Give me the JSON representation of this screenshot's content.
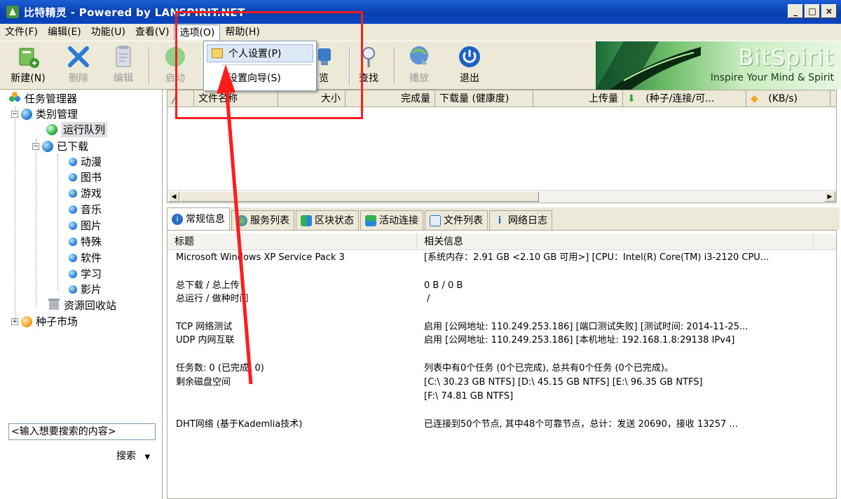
{
  "window": {
    "title": "比特精灵 - Powered by LANSPIRIT.NET",
    "buttons": [
      "_",
      "□",
      "×"
    ]
  },
  "menubar": {
    "items": [
      "文件(F)",
      "编辑(E)",
      "功能(U)",
      "查看(V)",
      "选项(O)",
      "帮助(H)"
    ]
  },
  "toolbar": {
    "buttons": [
      {
        "label": "新建(N)",
        "icon": "new-task-icon"
      },
      {
        "label": "删除",
        "icon": "delete-icon",
        "disabled": true
      },
      {
        "label": "编辑",
        "icon": "edit-icon",
        "disabled": true
      },
      {
        "label": "启动",
        "icon": "start-icon",
        "disabled": true
      },
      {
        "label": "览",
        "icon": "preview-icon"
      },
      {
        "label": "查找",
        "icon": "find-icon"
      },
      {
        "label": "播放",
        "icon": "play-icon",
        "disabled": true
      },
      {
        "label": "退出",
        "icon": "power-icon"
      }
    ]
  },
  "banner": {
    "title": "BitSpirit",
    "subtitle": "Inspire Your Mind & Spirit"
  },
  "options_menu": {
    "items": [
      "个人设置(P)",
      "设置向导(S)"
    ]
  },
  "tree": {
    "root": "任务管理器",
    "category": "类别管理",
    "running": "运行队列",
    "downloaded": "已下载",
    "subcategories": [
      "动漫",
      "图书",
      "游戏",
      "音乐",
      "图片",
      "特殊",
      "软件",
      "学习",
      "影片"
    ],
    "recycle": "资源回收站",
    "market": "种子市场"
  },
  "search": {
    "placeholder": "<输入想要搜索的内容>",
    "button": "搜索"
  },
  "list_columns": [
    "文件名称",
    "大小",
    "完成量",
    "下载量 (健康度)",
    "上传量",
    "(种子/连接/可...",
    "(KB/s)"
  ],
  "tabs": [
    "常规信息",
    "服务列表",
    "区块状态",
    "活动连接",
    "文件列表",
    "网络日志"
  ],
  "info": {
    "headers": [
      "标题",
      "相关信息"
    ],
    "rows": [
      {
        "label": "Microsoft Windows XP Service Pack 3",
        "value": "[系统内存：2.91 GB <2.10 GB 可用>] [CPU：Intel(R) Core(TM) i3-2120 CPU..."
      },
      {
        "label": "总下载 / 总上传",
        "value": "0 B / 0 B"
      },
      {
        "label": "总运行 / 做种时间",
        "value": "/"
      },
      {
        "label": "TCP 网络测试",
        "value": "启用 [公网地址: 110.249.253.186] [端口测试失败] [测试时间: 2014-11-25..."
      },
      {
        "label": "UDP 内网互联",
        "value": "启用 [公网地址: 110.249.253.186] [本机地址: 192.168.1.8:29138 IPv4]"
      },
      {
        "label": "任务数: 0 (已完成: 0)",
        "value": "列表中有0个任务 (0个已完成), 总共有0个任务 (0个已完成)。"
      },
      {
        "label": "剩余磁盘空间",
        "value": "[C:\\ 30.23 GB NTFS] [D:\\ 45.15 GB NTFS] [E:\\ 96.35 GB NTFS]"
      },
      {
        "label": "",
        "value": "[F:\\ 74.81 GB NTFS]"
      },
      {
        "label": "DHT网络 (基于Kademlia技术)",
        "value": "已连接到50个节点, 其中48个可靠节点，总计：发送 20690，接收 13257 ..."
      }
    ]
  },
  "colors": {
    "titlebar": "#0a3fb0",
    "annotation": "#ff1c1c",
    "chrome": "#ece9d8"
  }
}
